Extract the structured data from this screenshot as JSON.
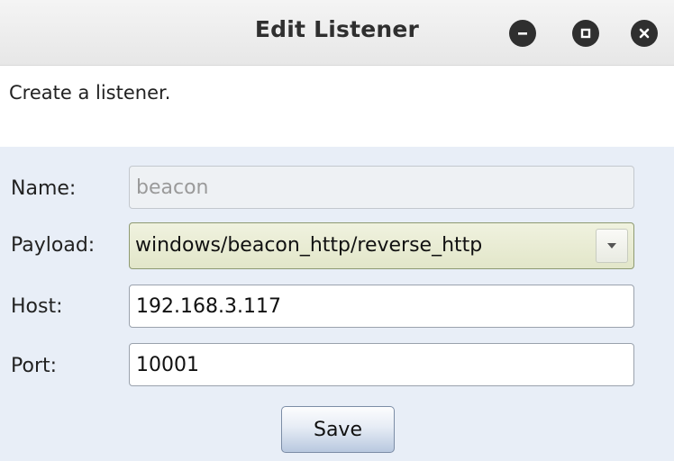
{
  "window": {
    "title": "Edit Listener",
    "controls": [
      "minimize-icon",
      "maximize-icon",
      "close-icon"
    ]
  },
  "description": "Create a listener.",
  "form": {
    "name": {
      "label": "Name:",
      "value": "beacon",
      "disabled": true
    },
    "payload": {
      "label": "Payload:",
      "value": "windows/beacon_http/reverse_http"
    },
    "host": {
      "label": "Host:",
      "value": "192.168.3.117"
    },
    "port": {
      "label": "Port:",
      "value": "10001"
    }
  },
  "actions": {
    "save_label": "Save"
  },
  "colors": {
    "background": "#e8eef7",
    "titlebar": "#efefef",
    "window_button": "#2f2f2f",
    "select_highlight": "#e6e9cf"
  }
}
